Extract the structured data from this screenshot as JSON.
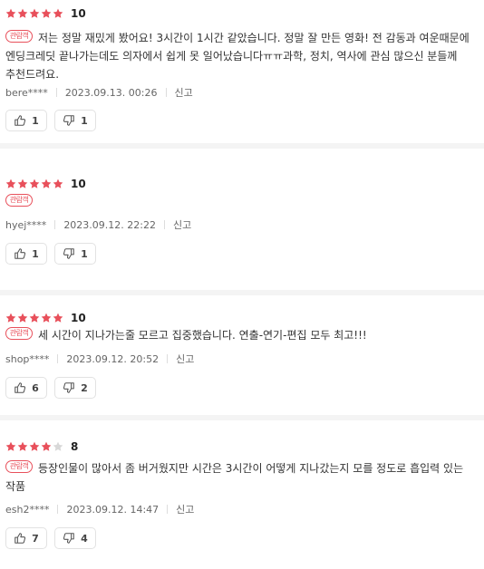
{
  "colors": {
    "star_filled": "#e8505b",
    "star_empty": "#d8d8d8",
    "badge": "#e8505b"
  },
  "reviews": [
    {
      "stars_filled": 5,
      "score": "10",
      "badge": "관람객",
      "text": "저는 정말 재밌게 봤어요! 3시간이 1시간 같았습니다. 정말 잘 만든 영화! 전 감동과 여운때문에 엔딩크레딧 끝나가는데도 의자에서 쉽게 못 일어났습니다ㅠㅠ과학, 정치, 역사에 관심 많으신 분들께 추천드려요.",
      "user": "bere****",
      "date": "2023.09.13. 00:26",
      "report": "신고",
      "likes": "1",
      "dislikes": "1"
    },
    {
      "stars_filled": 5,
      "score": "10",
      "badge": "관람객",
      "text": "",
      "user": "hyej****",
      "date": "2023.09.12. 22:22",
      "report": "신고",
      "likes": "1",
      "dislikes": "1"
    },
    {
      "stars_filled": 5,
      "score": "10",
      "badge": "관람객",
      "text": "세 시간이 지나가는줄 모르고 집중했습니다. 연출-연기-편집 모두 최고!!!",
      "user": "shop****",
      "date": "2023.09.12. 20:52",
      "report": "신고",
      "likes": "6",
      "dislikes": "2"
    },
    {
      "stars_filled": 4,
      "score": "8",
      "badge": "관람객",
      "text": "등장인물이 많아서 좀 버거웠지만 시간은 3시간이 어떻게 지나갔는지 모를 정도로 흡입력 있는 작품",
      "user": "esh2****",
      "date": "2023.09.12. 14:47",
      "report": "신고",
      "likes": "7",
      "dislikes": "4"
    }
  ]
}
